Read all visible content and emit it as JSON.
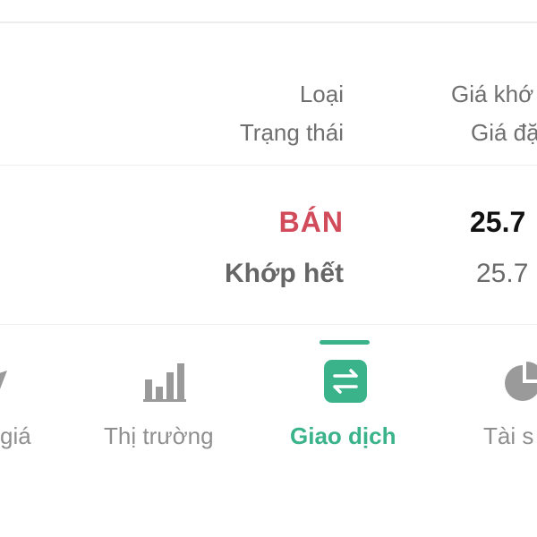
{
  "table": {
    "header": {
      "col1_line1": "Loại",
      "col1_line2": "Trạng thái",
      "col2_line1": "Giá khớ",
      "col2_line2": "Giá đặ"
    },
    "order": {
      "side": "BÁN",
      "status": "Khớp hết",
      "price_main": "25.7",
      "price_sub": "25.7"
    }
  },
  "bottom_nav": {
    "items": [
      {
        "label": "giá",
        "icon": "price-icon",
        "active": false
      },
      {
        "label": "Thị trường",
        "icon": "bar-chart-icon",
        "active": false
      },
      {
        "label": "Giao dịch",
        "icon": "transfer-icon",
        "active": true
      },
      {
        "label": "Tài s",
        "icon": "pie-chart-icon",
        "active": false
      }
    ]
  },
  "colors": {
    "accent": "#3bb38a",
    "sell": "#d14b5a",
    "muted": "#8f8f8f"
  }
}
